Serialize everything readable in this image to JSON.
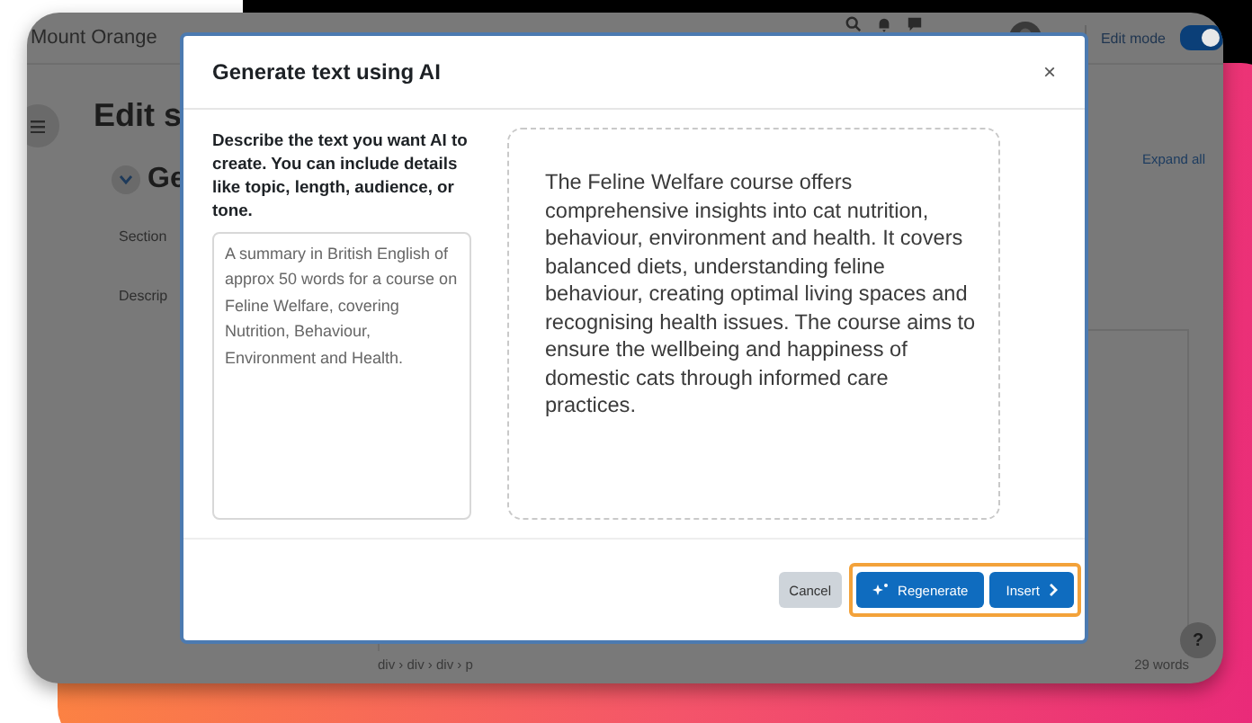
{
  "page": {
    "site_name": "Mount Orange",
    "edit_mode": {
      "label": "Edit mode",
      "on": true
    },
    "heading": "Edit s",
    "section": {
      "title": "Ge",
      "expanded": true
    },
    "fields": [
      "Section",
      "Descrip"
    ],
    "expand_all": "Expand all",
    "editor": {
      "path": "div › div › div › p",
      "word_count": "29 words"
    },
    "help": "?"
  },
  "dialog": {
    "title": "Generate text using AI",
    "close": "×",
    "prompt_label": "Describe the text you want AI to create. You can include details like topic, length, audience, or tone.",
    "prompt_value": "A summary in British English of approx 50 words for a course on Feline Welfare, covering Nutrition, Behaviour, Environment and Health.",
    "output": "The Feline Welfare course offers comprehensive insights into cat nutrition, behaviour, environment and health. It covers balanced diets, understanding feline behaviour, creating optimal living spaces and recognising health issues. The course aims to ensure the wellbeing and happiness of domestic cats through informed care practices.",
    "actions_highlighted": true,
    "buttons": [
      {
        "label": "Cancel",
        "kind": "secondary"
      },
      {
        "label": "Regenerate",
        "kind": "regenerate"
      },
      {
        "label": "Insert",
        "kind": "insert"
      }
    ]
  }
}
